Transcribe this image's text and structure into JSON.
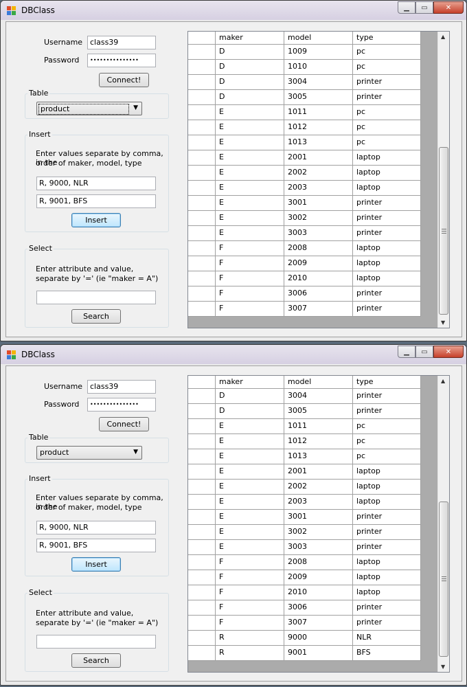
{
  "windows": [
    {
      "title": "DBClass",
      "username_label": "Username",
      "username_value": "class39",
      "password_label": "Password",
      "password_value": "•••••••••••••••",
      "connect_label": "Connect!",
      "table_group": "Table",
      "table_selected": "product",
      "insert_group": "Insert",
      "insert_instructions_1": "Enter values separate by comma, in the",
      "insert_instructions_2": "order of maker, model, type",
      "insert_value_1": "R, 9000, NLR",
      "insert_value_2": "R, 9001, BFS",
      "insert_label": "Insert",
      "select_group": "Select",
      "select_instructions_1": "Enter attribute and value,",
      "select_instructions_2": "separate by '=' (ie \"maker = A\")",
      "select_value": "",
      "search_label": "Search",
      "columns": [
        "maker",
        "model",
        "type"
      ],
      "rows": [
        [
          "D",
          "1009",
          "pc"
        ],
        [
          "D",
          "1010",
          "pc"
        ],
        [
          "D",
          "3004",
          "printer"
        ],
        [
          "D",
          "3005",
          "printer"
        ],
        [
          "E",
          "1011",
          "pc"
        ],
        [
          "E",
          "1012",
          "pc"
        ],
        [
          "E",
          "1013",
          "pc"
        ],
        [
          "E",
          "2001",
          "laptop"
        ],
        [
          "E",
          "2002",
          "laptop"
        ],
        [
          "E",
          "2003",
          "laptop"
        ],
        [
          "E",
          "3001",
          "printer"
        ],
        [
          "E",
          "3002",
          "printer"
        ],
        [
          "E",
          "3003",
          "printer"
        ],
        [
          "F",
          "2008",
          "laptop"
        ],
        [
          "F",
          "2009",
          "laptop"
        ],
        [
          "F",
          "2010",
          "laptop"
        ],
        [
          "F",
          "3006",
          "printer"
        ],
        [
          "F",
          "3007",
          "printer"
        ]
      ]
    },
    {
      "title": "DBClass",
      "username_label": "Username",
      "username_value": "class39",
      "password_label": "Password",
      "password_value": "•••••••••••••••",
      "connect_label": "Connect!",
      "table_group": "Table",
      "table_selected": "product",
      "insert_group": "Insert",
      "insert_instructions_1": "Enter values separate by comma, in the",
      "insert_instructions_2": "order of maker, model, type",
      "insert_value_1": "R, 9000, NLR",
      "insert_value_2": "R, 9001, BFS",
      "insert_label": "Insert",
      "select_group": "Select",
      "select_instructions_1": "Enter attribute and value,",
      "select_instructions_2": "separate by '=' (ie \"maker = A\")",
      "select_value": "",
      "search_label": "Search",
      "columns": [
        "maker",
        "model",
        "type"
      ],
      "rows": [
        [
          "D",
          "3004",
          "printer"
        ],
        [
          "D",
          "3005",
          "printer"
        ],
        [
          "E",
          "1011",
          "pc"
        ],
        [
          "E",
          "1012",
          "pc"
        ],
        [
          "E",
          "1013",
          "pc"
        ],
        [
          "E",
          "2001",
          "laptop"
        ],
        [
          "E",
          "2002",
          "laptop"
        ],
        [
          "E",
          "2003",
          "laptop"
        ],
        [
          "E",
          "3001",
          "printer"
        ],
        [
          "E",
          "3002",
          "printer"
        ],
        [
          "E",
          "3003",
          "printer"
        ],
        [
          "F",
          "2008",
          "laptop"
        ],
        [
          "F",
          "2009",
          "laptop"
        ],
        [
          "F",
          "2010",
          "laptop"
        ],
        [
          "F",
          "3006",
          "printer"
        ],
        [
          "F",
          "3007",
          "printer"
        ],
        [
          "R",
          "9000",
          "NLR"
        ],
        [
          "R",
          "9001",
          "BFS"
        ]
      ]
    }
  ]
}
